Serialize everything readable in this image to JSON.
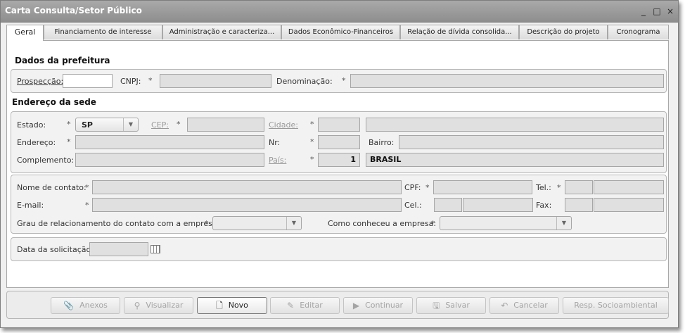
{
  "window": {
    "title": "Carta Consulta/Setor Público",
    "minimize": "_",
    "maximize": "□",
    "close": "×"
  },
  "tabs": [
    "Geral",
    "Financiamento de interesse",
    "Administração e caracteriza...",
    "Dados Econômico-Financeiros",
    "Relação de dívida consolida...",
    "Descrição do projeto",
    "Cronograma"
  ],
  "prefeitura": {
    "title": "Dados da prefeitura",
    "prospeccao_label": "Prospecção:",
    "prospeccao_value": "",
    "cnpj_label": "CNPJ:",
    "cnpj_value": "",
    "denominacao_label": "Denominação:",
    "denominacao_value": ""
  },
  "endereco": {
    "title": "Endereço da sede",
    "estado_label": "Estado:",
    "estado_value": "SP",
    "cep_label": "CEP:",
    "cidade_label": "Cidade:",
    "endereco_label": "Endereço:",
    "nr_label": "Nr:",
    "bairro_label": "Bairro:",
    "complemento_label": "Complemento:",
    "pais_label": "País:",
    "pais_code": "1",
    "pais_name": "BRASIL"
  },
  "contato": {
    "nome_label": "Nome de contato:",
    "cpf_label": "CPF:",
    "tel_label": "Tel.:",
    "email_label": "E-mail:",
    "cel_label": "Cel.:",
    "fax_label": "Fax:",
    "grau_label": "Grau de relacionamento do contato com a empresa:",
    "conheceu_label": "Como conheceu a empresa:"
  },
  "solicitacao": {
    "data_label": "Data da solicitação:",
    "data_value": ""
  },
  "required_mark": "*",
  "buttons": [
    {
      "label": "Anexos",
      "icon": "paperclip-icon",
      "glyph": "📎",
      "enabled": false
    },
    {
      "label": "Visualizar",
      "icon": "magnifier-icon",
      "glyph": "⚲",
      "enabled": false
    },
    {
      "label": "Novo",
      "icon": "new-document-icon",
      "glyph": "🗋",
      "enabled": true
    },
    {
      "label": "Editar",
      "icon": "pencil-icon",
      "glyph": "✎",
      "enabled": false
    },
    {
      "label": "Continuar",
      "icon": "play-icon",
      "glyph": "▶",
      "enabled": false
    },
    {
      "label": "Salvar",
      "icon": "floppy-disk-icon",
      "glyph": "🖫",
      "enabled": false
    },
    {
      "label": "Cancelar",
      "icon": "undo-arrow-icon",
      "glyph": "↶",
      "enabled": false
    },
    {
      "label": "Resp. Socioambiental",
      "icon": "",
      "glyph": "",
      "enabled": false
    }
  ]
}
